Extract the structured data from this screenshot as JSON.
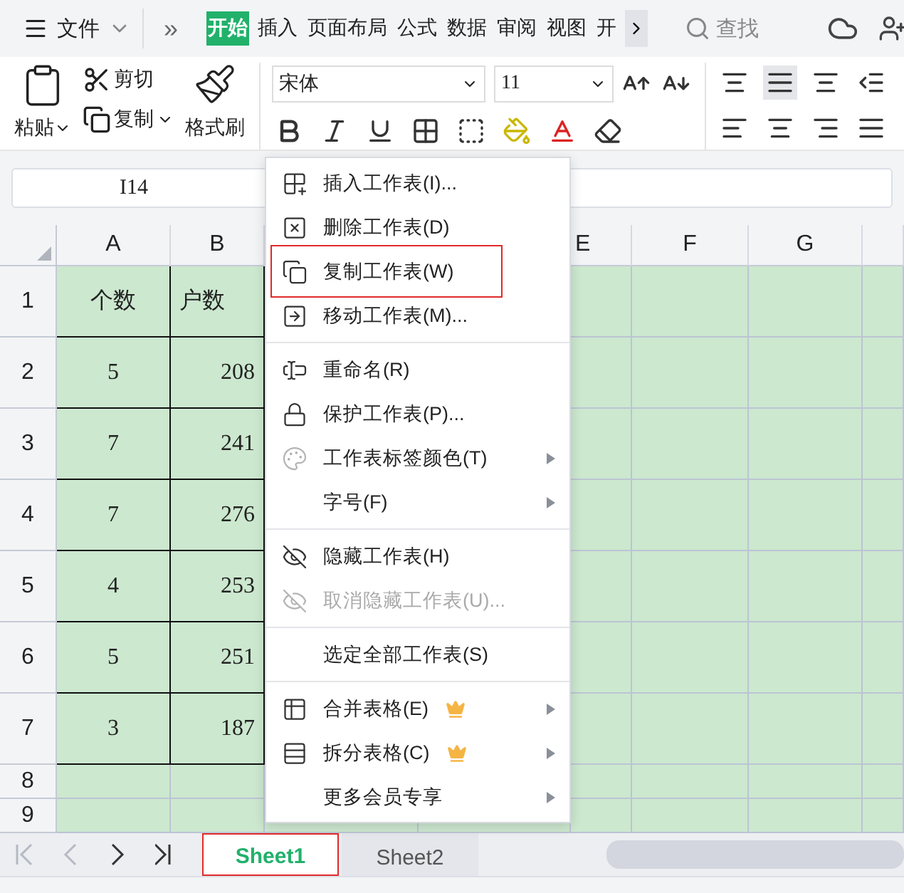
{
  "title_bar": {
    "file_menu": "文件",
    "overflow": "»",
    "ribbon_tabs": [
      {
        "label": "开始",
        "selected": true
      },
      {
        "label": "插入",
        "selected": false
      },
      {
        "label": "页面布局",
        "selected": false
      },
      {
        "label": "公式",
        "selected": false
      },
      {
        "label": "数据",
        "selected": false
      },
      {
        "label": "审阅",
        "selected": false
      },
      {
        "label": "视图",
        "selected": false
      },
      {
        "label": "开",
        "selected": false
      }
    ],
    "search": "查找"
  },
  "ribbon": {
    "paste": "粘贴",
    "cut": "剪切",
    "copy": "复制",
    "format_painter": "格式刷",
    "font_name": "宋体",
    "font_size": "11"
  },
  "name_box": "I14",
  "columns": [
    "A",
    "B",
    "E",
    "F",
    "G"
  ],
  "rows": [
    {
      "number": "1",
      "cells": [
        "个数",
        "户数"
      ]
    },
    {
      "number": "2",
      "cells": [
        "5",
        "208"
      ]
    },
    {
      "number": "3",
      "cells": [
        "7",
        "241"
      ]
    },
    {
      "number": "4",
      "cells": [
        "7",
        "276"
      ]
    },
    {
      "number": "5",
      "cells": [
        "4",
        "253"
      ]
    },
    {
      "number": "6",
      "cells": [
        "5",
        "251"
      ]
    },
    {
      "number": "7",
      "cells": [
        "3",
        "187"
      ]
    },
    {
      "number": "8",
      "cells": []
    },
    {
      "number": "9",
      "cells": []
    }
  ],
  "sheet_tabs": [
    {
      "label": "Sheet1",
      "selected": true,
      "annotated": true
    },
    {
      "label": "Sheet2",
      "selected": false,
      "annotated": false
    }
  ],
  "context_menu": [
    [
      {
        "label": "插入工作表(I)...",
        "submenu": false,
        "disabled": false,
        "premium": false,
        "annotated": false
      },
      {
        "label": "删除工作表(D)",
        "submenu": false,
        "disabled": false,
        "premium": false,
        "annotated": false
      },
      {
        "label": "复制工作表(W)",
        "submenu": false,
        "disabled": false,
        "premium": false,
        "annotated": true
      },
      {
        "label": "移动工作表(M)...",
        "submenu": false,
        "disabled": false,
        "premium": false,
        "annotated": false
      }
    ],
    [
      {
        "label": "重命名(R)",
        "submenu": false,
        "disabled": false,
        "premium": false,
        "annotated": false
      },
      {
        "label": "保护工作表(P)...",
        "submenu": false,
        "disabled": false,
        "premium": false,
        "annotated": false
      },
      {
        "label": "工作表标签颜色(T)",
        "submenu": true,
        "disabled": false,
        "premium": false,
        "annotated": false
      },
      {
        "label": "字号(F)",
        "submenu": true,
        "disabled": false,
        "premium": false,
        "annotated": false
      }
    ],
    [
      {
        "label": "隐藏工作表(H)",
        "submenu": false,
        "disabled": false,
        "premium": false,
        "annotated": false
      },
      {
        "label": "取消隐藏工作表(U)...",
        "submenu": false,
        "disabled": true,
        "premium": false,
        "annotated": false
      }
    ],
    [
      {
        "label": "选定全部工作表(S)",
        "submenu": false,
        "disabled": false,
        "premium": false,
        "annotated": false
      }
    ],
    [
      {
        "label": "合并表格(E)",
        "submenu": true,
        "disabled": false,
        "premium": true,
        "annotated": false
      },
      {
        "label": "拆分表格(C)",
        "submenu": true,
        "disabled": false,
        "premium": true,
        "annotated": false
      },
      {
        "label": "更多会员专享",
        "submenu": true,
        "disabled": false,
        "premium": false,
        "annotated": false
      }
    ]
  ]
}
